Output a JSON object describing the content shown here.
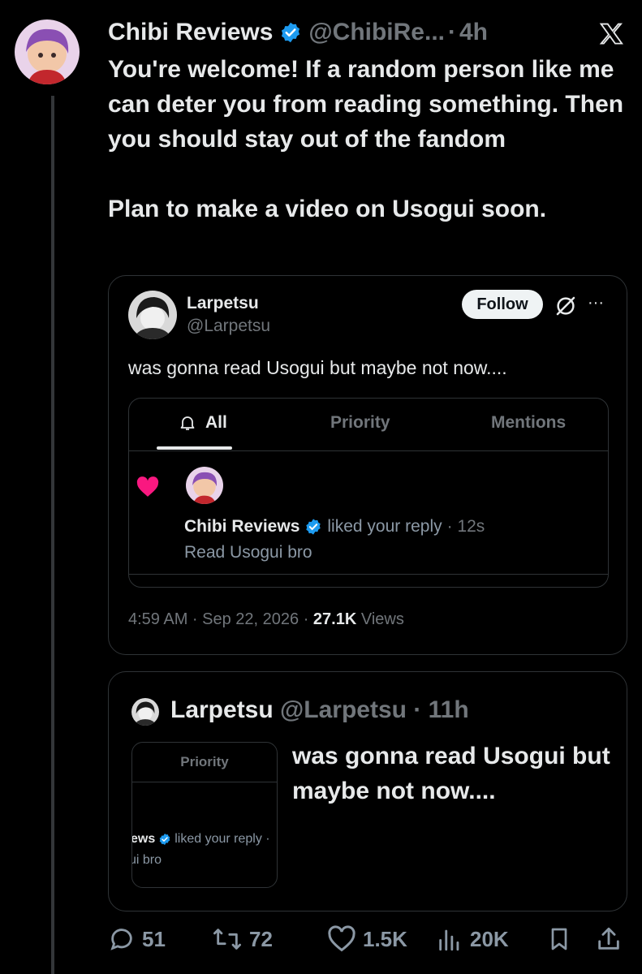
{
  "tweet": {
    "author_name": "Chibi Reviews",
    "handle": "@ChibiRe...",
    "time": "4h",
    "text": "You're welcome! If a random person like me can deter you from reading something. Then you should stay out of the fandom\n\nPlan to make a video on Usogui soon."
  },
  "quote": {
    "author_name": "Larpetsu",
    "handle": "@Larpetsu",
    "follow_label": "Follow",
    "more_label": "···",
    "text": "was gonna read Usogui but maybe not now....",
    "screenshot": {
      "tabs": [
        "All",
        "Priority",
        "Mentions"
      ],
      "notif_name": "Chibi Reviews",
      "notif_action": "liked your reply",
      "notif_time": "· 12s",
      "notif_reply": "Read Usogui bro"
    },
    "footer_time": "4:59 AM · Sep 22, 2026 · ",
    "views_count": "27.1K",
    "views_label": " Views"
  },
  "quote2": {
    "author_name": "Larpetsu",
    "handle_time": "@Larpetsu · 11h",
    "thumb_tab": "Priority",
    "thumb_name": "ews",
    "thumb_action": "liked your reply ·",
    "thumb_reply": "ui bro",
    "text": "was gonna read Usogui but maybe not now...."
  },
  "actions": {
    "replies": "51",
    "reposts": "72",
    "likes": "1.5K",
    "views": "20K"
  },
  "colors": {
    "background": "#000000",
    "verified": "#1d9bf0",
    "like_heart": "#f91880",
    "muted": "#71767b"
  }
}
